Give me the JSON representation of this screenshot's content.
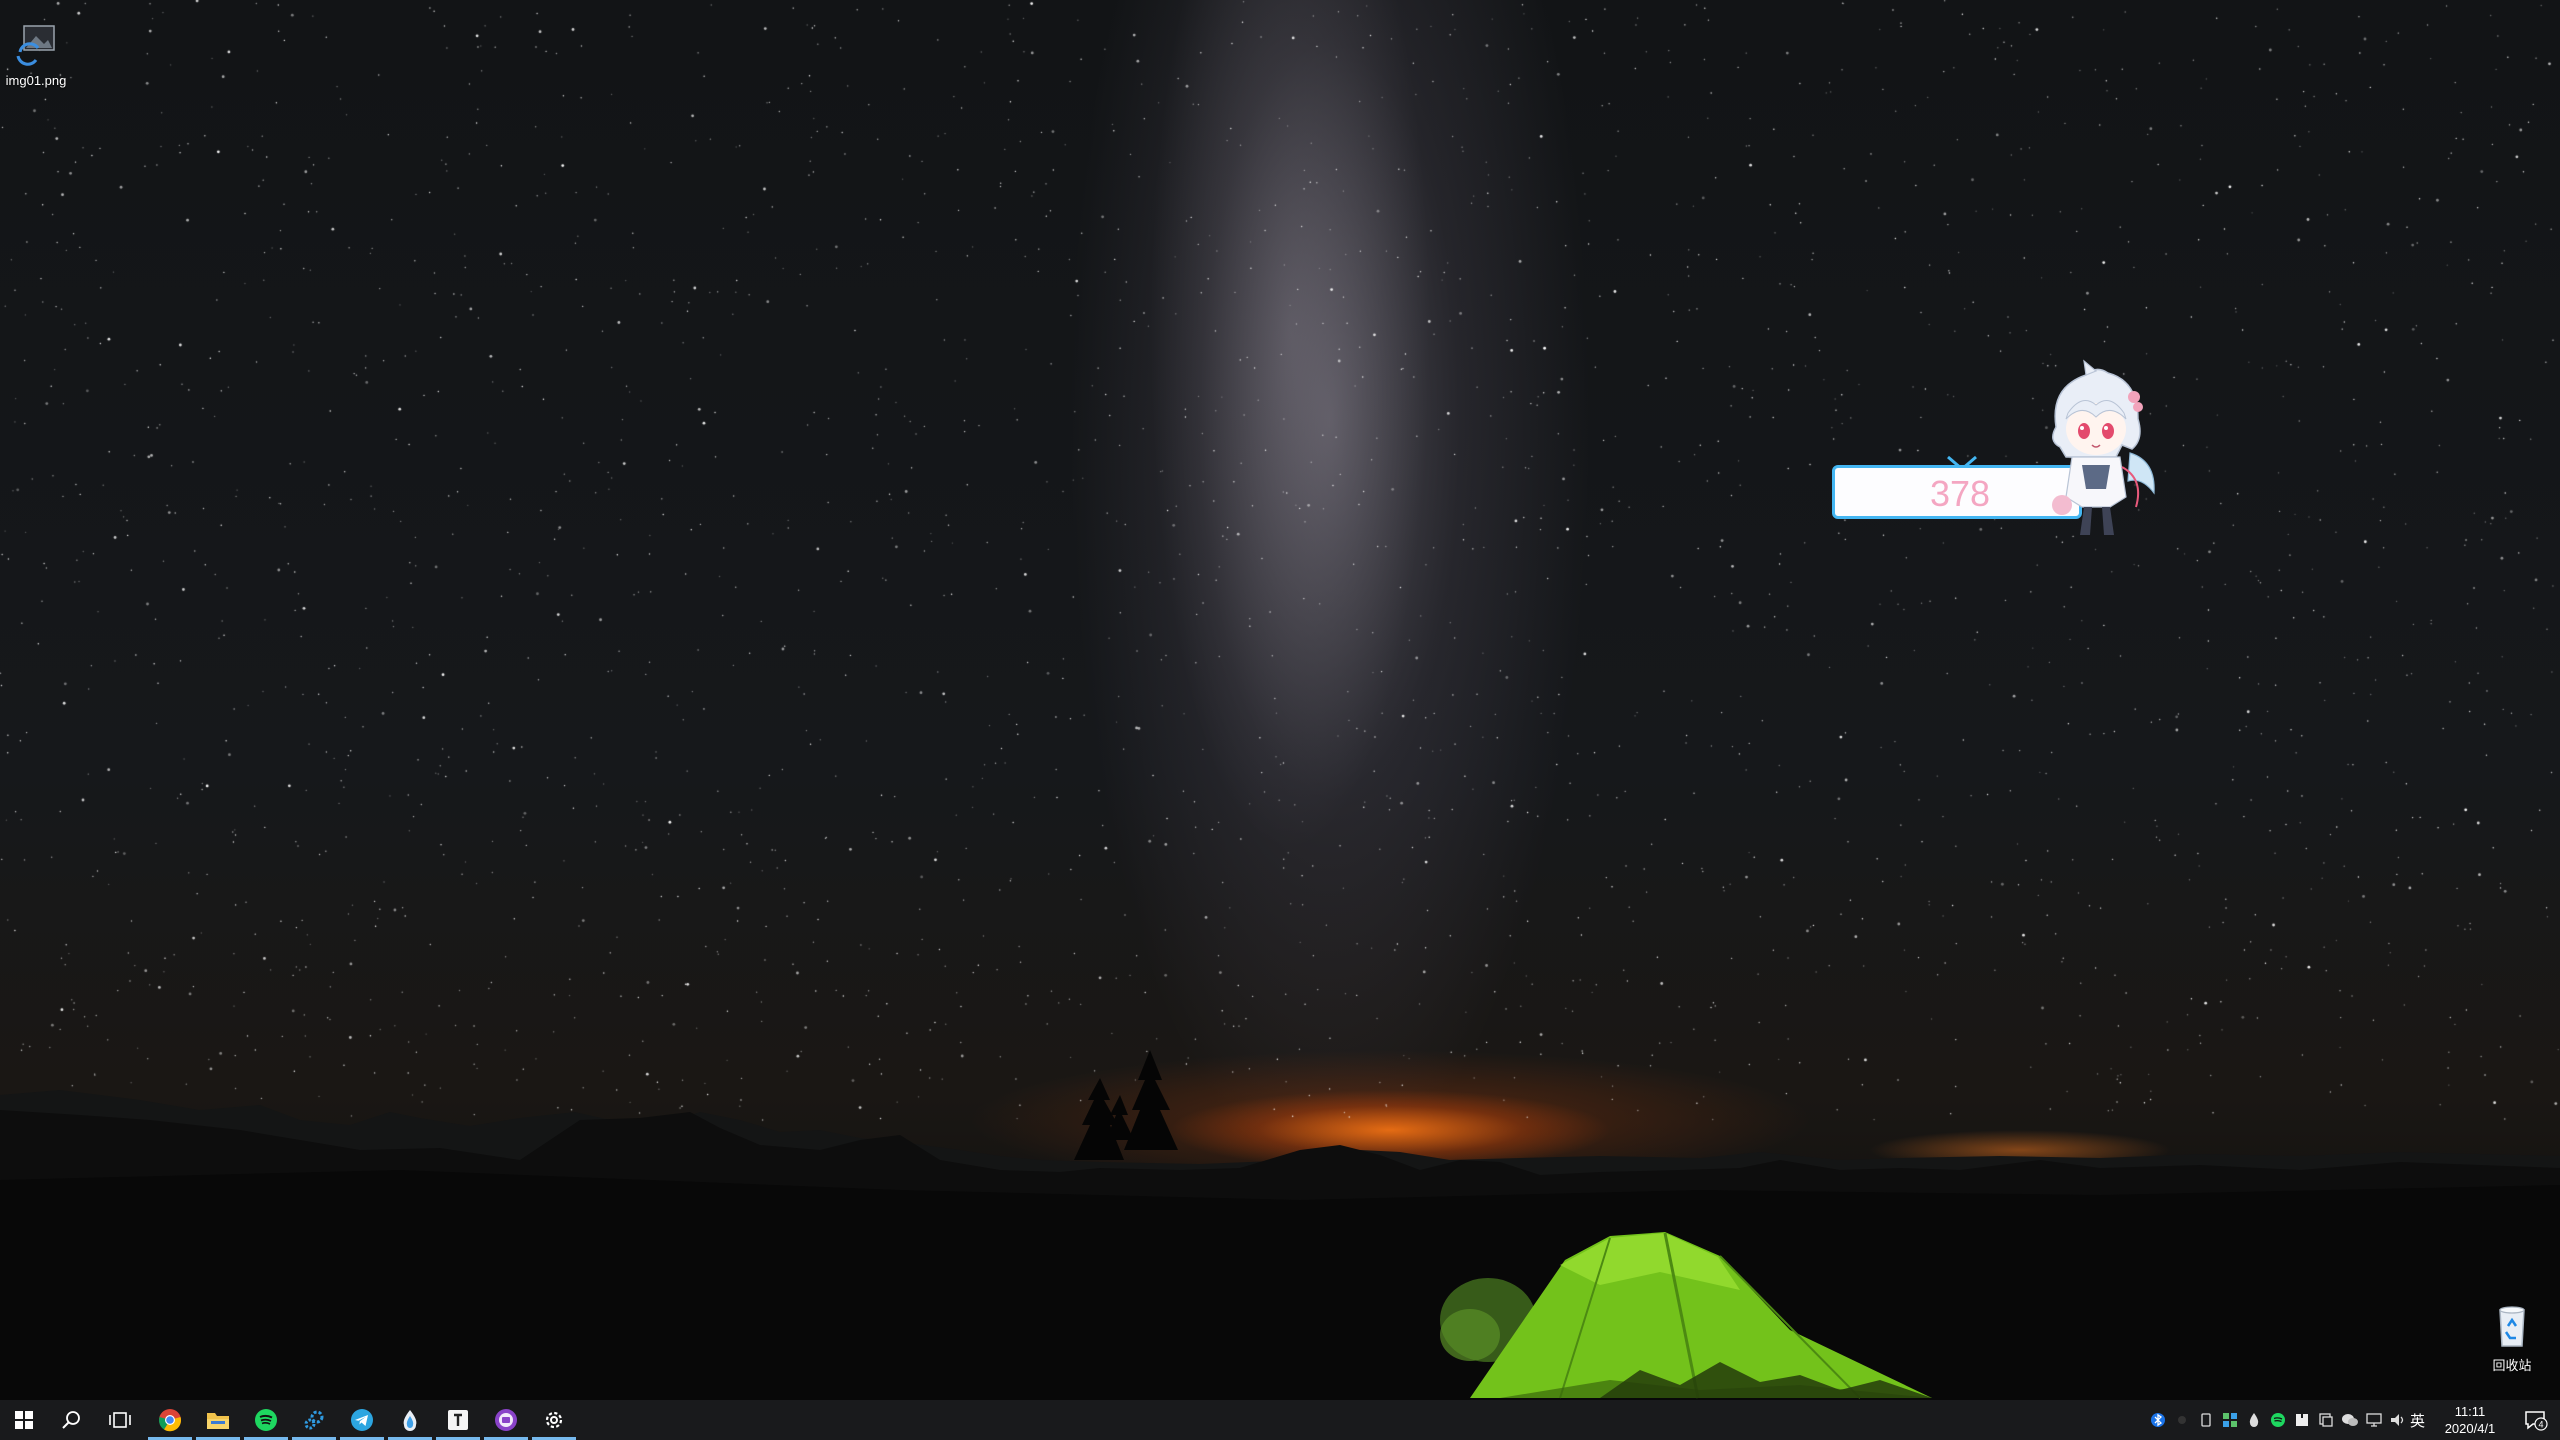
{
  "desktop": {
    "icons": [
      {
        "label": "img01.png",
        "icon": "image-file-icon"
      },
      {
        "label": "回收站",
        "icon": "recycle-bin-icon"
      }
    ]
  },
  "widget": {
    "counter_value": "378",
    "border_color": "#44b6f2",
    "text_color": "#f4a6c2"
  },
  "taskbar": {
    "apps": [
      {
        "name": "start-icon"
      },
      {
        "name": "search-icon"
      },
      {
        "name": "task-view-icon"
      },
      {
        "name": "chrome-icon",
        "active": true
      },
      {
        "name": "file-explorer-icon",
        "active": true
      },
      {
        "name": "spotify-icon",
        "active": true
      },
      {
        "name": "gear-app-icon",
        "active": true
      },
      {
        "name": "telegram-icon",
        "active": true
      },
      {
        "name": "drop-app-icon",
        "active": true
      },
      {
        "name": "typora-icon",
        "active": true
      },
      {
        "name": "purple-app-icon",
        "active": true
      },
      {
        "name": "settings-icon",
        "active": true
      }
    ],
    "tray": {
      "language": "英",
      "time": "11:11",
      "date": "2020/4/1",
      "notification_count": "4"
    },
    "accent_color": "#76b9ed"
  }
}
